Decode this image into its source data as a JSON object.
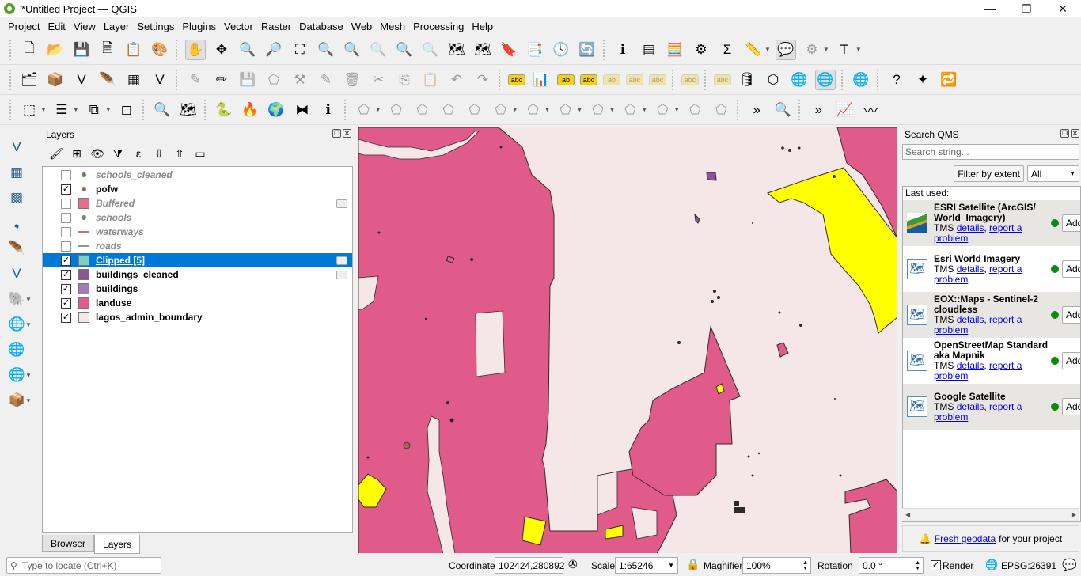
{
  "window": {
    "title": "*Untitled Project — QGIS",
    "minimize": "—",
    "restore": "❐",
    "close": "✕"
  },
  "menu": [
    "Project",
    "Edit",
    "View",
    "Layer",
    "Settings",
    "Plugins",
    "Vector",
    "Raster",
    "Database",
    "Web",
    "Mesh",
    "Processing",
    "Help"
  ],
  "toolbar1": [
    {
      "name": "new-project-icon",
      "g": "🗋"
    },
    {
      "name": "open-project-icon",
      "g": "📂"
    },
    {
      "name": "save-project-icon",
      "g": "💾"
    },
    {
      "name": "new-print-layout-icon",
      "g": "🗎"
    },
    {
      "name": "layout-manager-icon",
      "g": "📋"
    },
    {
      "name": "style-manager-icon",
      "g": "🎨"
    },
    {
      "name": "pan-map-icon",
      "g": "✋",
      "active": true
    },
    {
      "name": "pan-to-selection-icon",
      "g": "✥"
    },
    {
      "name": "zoom-in-icon",
      "g": "🔍"
    },
    {
      "name": "zoom-out-icon",
      "g": "🔎"
    },
    {
      "name": "zoom-full-icon",
      "g": "⛶"
    },
    {
      "name": "zoom-to-selection-icon",
      "g": "🔍"
    },
    {
      "name": "zoom-to-layer-icon",
      "g": "🔍"
    },
    {
      "name": "zoom-native-icon",
      "g": "🔍",
      "dis": true
    },
    {
      "name": "zoom-last-icon",
      "g": "🔍"
    },
    {
      "name": "zoom-next-icon",
      "g": "🔍",
      "dis": true
    },
    {
      "name": "new-map-view-icon",
      "g": "🗺"
    },
    {
      "name": "new-3d-map-view-icon",
      "g": "🗺"
    },
    {
      "name": "new-bookmark-icon",
      "g": "🔖"
    },
    {
      "name": "show-bookmarks-icon",
      "g": "📑"
    },
    {
      "name": "temporal-controller-icon",
      "g": "🕓"
    },
    {
      "name": "refresh-icon",
      "g": "🔄"
    },
    {
      "name": "identify-features-icon",
      "g": "ℹ"
    },
    {
      "name": "attribute-table-icon",
      "g": "▤"
    },
    {
      "name": "field-calculator-icon",
      "g": "🧮"
    },
    {
      "name": "processing-toolbox-icon",
      "g": "⚙"
    },
    {
      "name": "statistical-summary-icon",
      "g": "Σ"
    },
    {
      "name": "measure-line-icon",
      "g": "📏",
      "dd": true
    },
    {
      "name": "map-tips-icon",
      "g": "💬",
      "active": true
    },
    {
      "name": "run-action-icon",
      "g": "⚙",
      "dis": true,
      "dd": true
    },
    {
      "name": "text-annotation-icon",
      "g": "T",
      "dd": true
    }
  ],
  "toolbar2": [
    {
      "name": "data-source-manager-icon",
      "g": "🗂"
    },
    {
      "name": "new-geopackage-layer-icon",
      "g": "📦"
    },
    {
      "name": "new-shapefile-layer-icon",
      "g": "V"
    },
    {
      "name": "new-temporary-layer-icon",
      "g": "🪶"
    },
    {
      "name": "new-virtual-layer-icon",
      "g": "▦"
    },
    {
      "name": "new-mesh-layer-icon",
      "g": "V"
    },
    {
      "name": "current-edits-icon",
      "g": "✎",
      "dis": true
    },
    {
      "name": "toggle-editing-icon",
      "g": "✏"
    },
    {
      "name": "save-edits-icon",
      "g": "💾",
      "dis": true
    },
    {
      "name": "add-polygon-icon",
      "g": "⬠",
      "dis": true
    },
    {
      "name": "vertex-tool-icon",
      "g": "⚒",
      "dis": true
    },
    {
      "name": "modify-attributes-icon",
      "g": "✎",
      "dis": true
    },
    {
      "name": "delete-selected-icon",
      "g": "🗑",
      "dis": true
    },
    {
      "name": "cut-features-icon",
      "g": "✂",
      "dis": true
    },
    {
      "name": "copy-features-icon",
      "g": "⎘",
      "dis": true
    },
    {
      "name": "paste-features-icon",
      "g": "📋",
      "dis": true
    },
    {
      "name": "undo-icon",
      "g": "↶",
      "dis": true
    },
    {
      "name": "redo-icon",
      "g": "↷",
      "dis": true
    },
    {
      "name": "label-settings-icon",
      "g": "abc"
    },
    {
      "name": "diagram-icon",
      "g": "📊"
    },
    {
      "name": "pin-labels-icon",
      "g": "ab"
    },
    {
      "name": "highlight-labels-icon",
      "g": "abc"
    },
    {
      "name": "show-hide-labels-icon",
      "g": "ab",
      "dis": true
    },
    {
      "name": "move-label-icon",
      "g": "abc",
      "dis": true
    },
    {
      "name": "rotate-label-icon",
      "g": "abc",
      "dis": true
    },
    {
      "name": "change-label-icon",
      "g": "abc",
      "dis": true
    },
    {
      "name": "label-props-icon",
      "g": "abc",
      "dis": true
    },
    {
      "name": "db-manager-icon",
      "g": "🛢"
    },
    {
      "name": "topology-checker-icon",
      "g": "⬡"
    },
    {
      "name": "qms-add-icon",
      "g": "🌐"
    },
    {
      "name": "qms-search-icon",
      "g": "🌐",
      "active": true
    },
    {
      "name": "geocoding-icon",
      "g": "🌐"
    },
    {
      "name": "help-icon",
      "g": "?"
    },
    {
      "name": "georeferencer-icon",
      "g": "✦"
    },
    {
      "name": "refresh-table-icon",
      "g": "🔁"
    }
  ],
  "toolbar3": [
    {
      "name": "select-features-icon",
      "g": "⬚",
      "dd": true
    },
    {
      "name": "select-by-value-icon",
      "g": "☰",
      "dd": true
    },
    {
      "name": "deselect-icon",
      "g": "⧉",
      "dd": true
    },
    {
      "name": "select-location-icon",
      "g": "◻"
    },
    {
      "name": "search-plugin-icon",
      "g": "🔍"
    },
    {
      "name": "plugin-map-icon",
      "g": "🗺"
    },
    {
      "name": "python-console-icon",
      "g": "🐍"
    },
    {
      "name": "heatmap-icon",
      "g": "🔥"
    },
    {
      "name": "globe-icon",
      "g": "🌍"
    },
    {
      "name": "map-swipe-icon",
      "g": "⧓"
    },
    {
      "name": "identify-plugin-icon",
      "g": "ℹ"
    },
    {
      "name": "digitize-1-icon",
      "g": "⬠",
      "dis": true,
      "dd": true
    },
    {
      "name": "digitize-2-icon",
      "g": "⬠",
      "dis": true
    },
    {
      "name": "digitize-3-icon",
      "g": "⬠",
      "dis": true
    },
    {
      "name": "digitize-4-icon",
      "g": "⬠",
      "dis": true
    },
    {
      "name": "digitize-5-icon",
      "g": "⬠",
      "dis": true
    },
    {
      "name": "digitize-6-icon",
      "g": "⬠",
      "dis": true,
      "dd": true
    },
    {
      "name": "digitize-7-icon",
      "g": "⬠",
      "dis": true,
      "dd": true
    },
    {
      "name": "digitize-8-icon",
      "g": "⬠",
      "dis": true,
      "dd": true
    },
    {
      "name": "digitize-9-icon",
      "g": "⬠",
      "dis": true,
      "dd": true
    },
    {
      "name": "digitize-10-icon",
      "g": "⬠",
      "dis": true,
      "dd": true
    },
    {
      "name": "digitize-11-icon",
      "g": "⬠",
      "dis": true,
      "dd": true
    },
    {
      "name": "digitize-12-icon",
      "g": "⬠",
      "dis": true
    },
    {
      "name": "digitize-13-icon",
      "g": "⬠",
      "dis": true
    },
    {
      "name": "more-tools-icon",
      "g": "»"
    },
    {
      "name": "locate-icon",
      "g": "🔍"
    },
    {
      "name": "more-tools-2-icon",
      "g": "»"
    },
    {
      "name": "profile-tool-icon",
      "g": "📈"
    },
    {
      "name": "route-icon",
      "g": "〰"
    }
  ],
  "sidebar": [
    {
      "name": "add-vector-layer-icon",
      "g": "V"
    },
    {
      "name": "add-raster-layer-icon",
      "g": "▦"
    },
    {
      "name": "add-mesh-layer-icon",
      "g": "▩"
    },
    {
      "name": "add-delimited-text-icon",
      "g": "❟"
    },
    {
      "name": "add-spatialite-icon",
      "g": "🪶"
    },
    {
      "name": "add-virtual-layer-icon",
      "g": "V"
    },
    {
      "name": "add-postgis-icon",
      "g": "🐘",
      "dd": true
    },
    {
      "name": "add-wms-icon",
      "g": "🌐",
      "dd": true
    },
    {
      "name": "add-xyz-icon",
      "g": "🌐"
    },
    {
      "name": "add-wfs-icon",
      "g": "🌐",
      "dd": true
    },
    {
      "name": "add-geopackage-icon",
      "g": "📦",
      "dd": true
    }
  ],
  "layers_panel": {
    "title": "Layers",
    "tools": [
      {
        "name": "open-styling-icon",
        "g": "🖌"
      },
      {
        "name": "add-group-icon",
        "g": "⊞"
      },
      {
        "name": "manage-visibility-icon",
        "g": "👁"
      },
      {
        "name": "filter-legend-icon",
        "g": "⧩"
      },
      {
        "name": "filter-expression-icon",
        "g": "ε"
      },
      {
        "name": "expand-all-icon",
        "g": "⇩"
      },
      {
        "name": "collapse-all-icon",
        "g": "⇧"
      },
      {
        "name": "remove-layer-icon",
        "g": "▭"
      }
    ],
    "layers": [
      {
        "name": "schools_cleaned",
        "checked": false,
        "sym": "dot",
        "color": "#5a8a5a",
        "hidden": true
      },
      {
        "name": "pofw",
        "checked": true,
        "sym": "dot",
        "color": "#9a6a58",
        "hidden": false
      },
      {
        "name": "Buffered",
        "checked": false,
        "sym": "sq",
        "color": "#e46f8c",
        "hidden": true,
        "memory": true
      },
      {
        "name": "schools",
        "checked": false,
        "sym": "dot",
        "color": "#6a8a6a",
        "hidden": true
      },
      {
        "name": "waterways",
        "checked": false,
        "sym": "ln",
        "color": "#d46a74",
        "hidden": true
      },
      {
        "name": "roads",
        "checked": false,
        "sym": "ln",
        "color": "#8a9a9a",
        "hidden": true
      },
      {
        "name": "Clipped [5]",
        "checked": true,
        "sym": "sq",
        "color": "#7dcfbe",
        "hidden": false,
        "selected": true,
        "memory": true
      },
      {
        "name": "buildings_cleaned",
        "checked": true,
        "sym": "sq",
        "color": "#8b5597",
        "hidden": false,
        "memory": true
      },
      {
        "name": "buildings",
        "checked": true,
        "sym": "sq",
        "color": "#9d7eb9",
        "hidden": false
      },
      {
        "name": "landuse",
        "checked": true,
        "sym": "sq",
        "color": "#e05a8a",
        "hidden": false
      },
      {
        "name": "lagos_admin_boundary",
        "checked": true,
        "sym": "sq",
        "color": "#f5e6e8",
        "hidden": false
      }
    ],
    "tabs": [
      "Browser",
      "Layers"
    ],
    "active_tab": "Layers"
  },
  "map": {
    "landuse_color": "#e05a8a",
    "boundary_color": "#f5e6e8",
    "clipped_color": "#ffff00",
    "buildings_color": "#8b5597"
  },
  "qms": {
    "title": "Search QMS",
    "search_placeholder": "Search string...",
    "filter_button": "Filter by extent",
    "filter_select": "All",
    "last_used_label": "Last used:",
    "items": [
      {
        "name": "ESRI Satellite (ArcGIS/ World_Imagery)",
        "type": "TMS",
        "details": "details",
        "report": "report a problem",
        "add": "Add",
        "alt": true,
        "esri": true
      },
      {
        "name": "Esri World Imagery",
        "type": "TMS",
        "details": "details",
        "report": "report a problem",
        "add": "Add",
        "alt": false
      },
      {
        "name": "EOX::Maps - Sentinel-2 cloudless",
        "type": "TMS",
        "details": "details",
        "report": "report a problem",
        "add": "Add",
        "alt": true
      },
      {
        "name": "OpenStreetMap Standard aka Mapnik",
        "type": "TMS",
        "details": "details",
        "report": "report a problem",
        "add": "Add",
        "alt": false
      },
      {
        "name": "Google Satellite",
        "type": "TMS",
        "details": "details",
        "report": "report a problem",
        "add": "Add",
        "alt": true
      }
    ],
    "footer_link": "Fresh geodata",
    "footer_text": "for your project"
  },
  "statusbar": {
    "locator_placeholder": "Type to locate (Ctrl+K)",
    "coordinate_label": "Coordinate",
    "coordinate_value": "102424,280892",
    "scale_label": "Scale",
    "scale_value": "1:65246",
    "magnifier_label": "Magnifier",
    "magnifier_value": "100%",
    "rotation_label": "Rotation",
    "rotation_value": "0.0 °",
    "render_label": "Render",
    "render_checked": true,
    "crs": "EPSG:26391"
  }
}
